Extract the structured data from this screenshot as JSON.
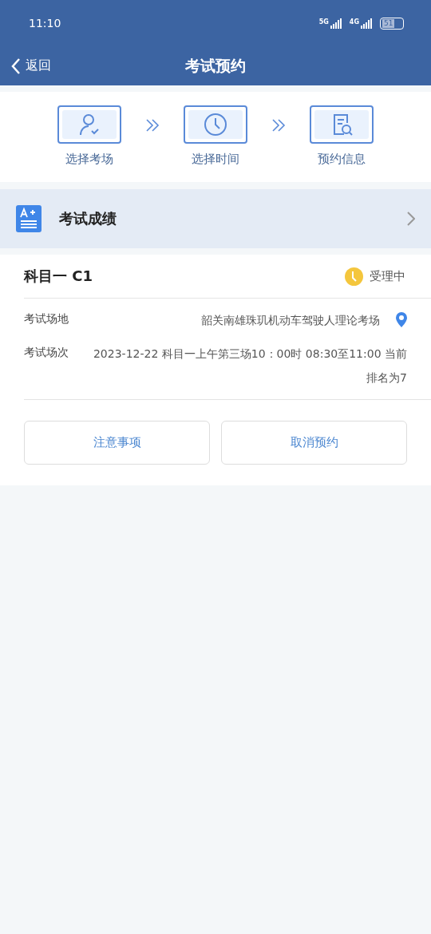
{
  "status_bar": {
    "time": "11:10",
    "network_1": "5G",
    "network_2": "4G",
    "battery": "51"
  },
  "header": {
    "back": "返回",
    "title": "考试预约"
  },
  "steps": [
    {
      "kind": "person",
      "label": "选择考场"
    },
    {
      "kind": "clock",
      "label": "选择时间"
    },
    {
      "kind": "document",
      "label": "预约信息"
    }
  ],
  "score_link": {
    "label": "考试成绩"
  },
  "booking": {
    "subject": "科目一 C1",
    "status": "受理中",
    "fields": [
      {
        "label": "考试场地",
        "value": "韶关南雄珠玑机动车驾驶人理论考场",
        "location": true
      },
      {
        "label": "考试场次",
        "value": "2023-12-22 科目一上午第三场10：00时 08:30至11:00 当前排名为7",
        "location": false
      }
    ],
    "buttons": [
      "注意事项",
      "取消预约"
    ]
  }
}
